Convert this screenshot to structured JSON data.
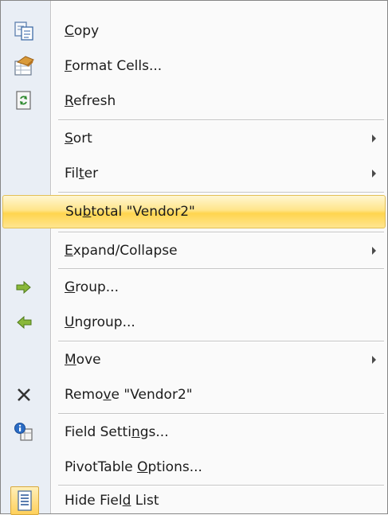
{
  "menu": {
    "items": [
      {
        "name": "copy",
        "label_pre": "",
        "accel": "C",
        "label_post": "opy",
        "icon": "copy-icon",
        "submenu": false
      },
      {
        "name": "format-cells",
        "label_pre": "",
        "accel": "F",
        "label_post": "ormat Cells...",
        "icon": "format-cells-icon",
        "submenu": false
      },
      {
        "name": "refresh",
        "label_pre": "",
        "accel": "R",
        "label_post": "efresh",
        "icon": "refresh-icon",
        "submenu": false
      },
      {
        "name": "sort",
        "label_pre": "",
        "accel": "S",
        "label_post": "ort",
        "icon": "",
        "submenu": true
      },
      {
        "name": "filter",
        "label_pre": "Fil",
        "accel": "t",
        "label_post": "er",
        "icon": "",
        "submenu": true
      },
      {
        "name": "subtotal",
        "label_pre": "Su",
        "accel": "b",
        "label_post": "total \"Vendor2\"",
        "icon": "",
        "submenu": false,
        "highlighted": true
      },
      {
        "name": "expand-collapse",
        "label_pre": "",
        "accel": "E",
        "label_post": "xpand/Collapse",
        "icon": "",
        "submenu": true
      },
      {
        "name": "group",
        "label_pre": "",
        "accel": "G",
        "label_post": "roup...",
        "icon": "group-arrow-icon",
        "submenu": false
      },
      {
        "name": "ungroup",
        "label_pre": "",
        "accel": "U",
        "label_post": "ngroup...",
        "icon": "ungroup-arrow-icon",
        "submenu": false
      },
      {
        "name": "move",
        "label_pre": "",
        "accel": "M",
        "label_post": "ove",
        "icon": "",
        "submenu": true
      },
      {
        "name": "remove",
        "label_pre": "Remo",
        "accel": "v",
        "label_post": "e \"Vendor2\"",
        "icon": "remove-x-icon",
        "submenu": false
      },
      {
        "name": "field-settings",
        "label_pre": "Field Setti",
        "accel": "n",
        "label_post": "gs...",
        "icon": "field-settings-icon",
        "submenu": false
      },
      {
        "name": "pivottable-options",
        "label_pre": "PivotTable ",
        "accel": "O",
        "label_post": "ptions...",
        "icon": "",
        "submenu": false
      },
      {
        "name": "hide-field-list",
        "label_pre": "Hide Fiel",
        "accel": "d",
        "label_post": " List",
        "icon": "field-list-icon",
        "submenu": false
      }
    ]
  },
  "colors": {
    "highlight": "#ffd54e",
    "gutter": "#e9eef5",
    "separator": "#c5c5c5"
  }
}
